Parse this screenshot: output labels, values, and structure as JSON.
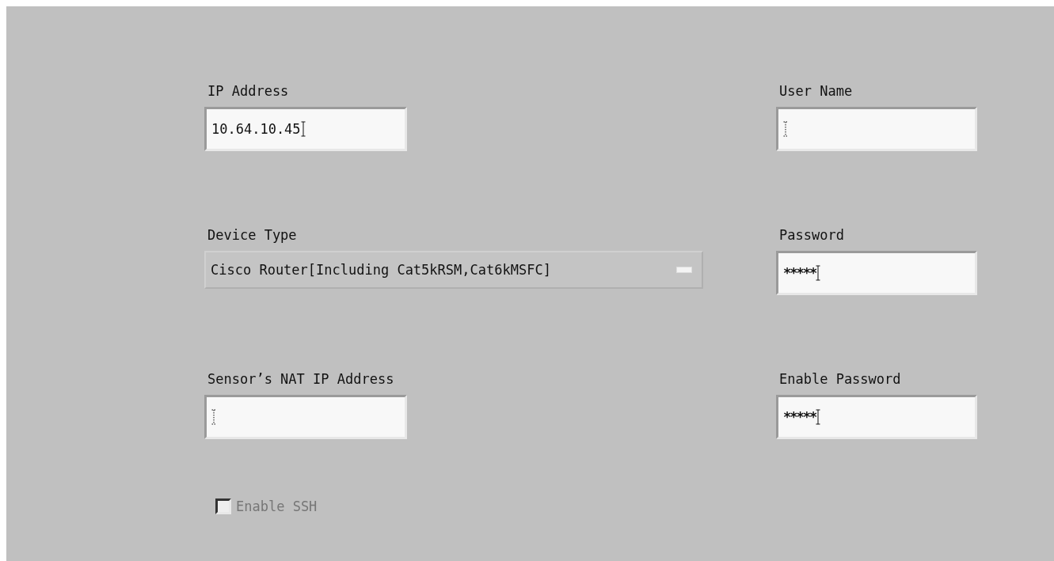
{
  "left_fields": [
    {
      "kind": "text",
      "label": "IP Address",
      "value": "10.64.10.45"
    },
    {
      "kind": "dropdown",
      "label": "Device Type",
      "value": "Cisco Router[Including Cat5kRSM,Cat6kMSFC]"
    },
    {
      "kind": "text",
      "label": "Sensor’s NAT IP Address"
    }
  ],
  "right_fields": [
    {
      "kind": "text",
      "label": "User Name"
    },
    {
      "kind": "password",
      "label": "Password",
      "value": "*****"
    },
    {
      "kind": "password",
      "label": "Enable Password",
      "value": "*****"
    }
  ],
  "checkbox": {
    "label": "Enable SSH",
    "checked": false,
    "disabled": true
  }
}
